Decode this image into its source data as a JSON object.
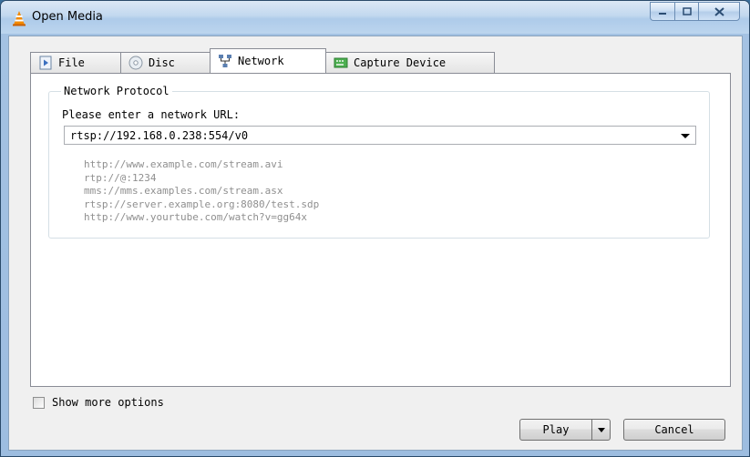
{
  "window": {
    "title": "Open Media",
    "minimize_icon": "minimize-icon",
    "maximize_icon": "maximize-icon",
    "close_icon": "close-icon"
  },
  "tabs": [
    {
      "label": "File",
      "icon": "file-icon"
    },
    {
      "label": "Disc",
      "icon": "disc-icon"
    },
    {
      "label": "Network",
      "icon": "network-icon",
      "active": true
    },
    {
      "label": "Capture Device",
      "icon": "capture-device-icon"
    }
  ],
  "network": {
    "group_title": "Network Protocol",
    "url_label": "Please enter a network URL:",
    "url_value": "rtsp://192.168.0.238:554/v0",
    "examples": [
      "http://www.example.com/stream.avi",
      "rtp://@:1234",
      "mms://mms.examples.com/stream.asx",
      "rtsp://server.example.org:8080/test.sdp",
      "http://www.yourtube.com/watch?v=gg64x"
    ]
  },
  "options": {
    "show_more_label": "Show more options",
    "show_more_checked": false
  },
  "buttons": {
    "play_label": "Play",
    "cancel_label": "Cancel"
  },
  "colors": {
    "title_bar": "#c2d8ef",
    "hint_text": "#8f8f8f",
    "dialog_bg": "#f0f0f0"
  }
}
